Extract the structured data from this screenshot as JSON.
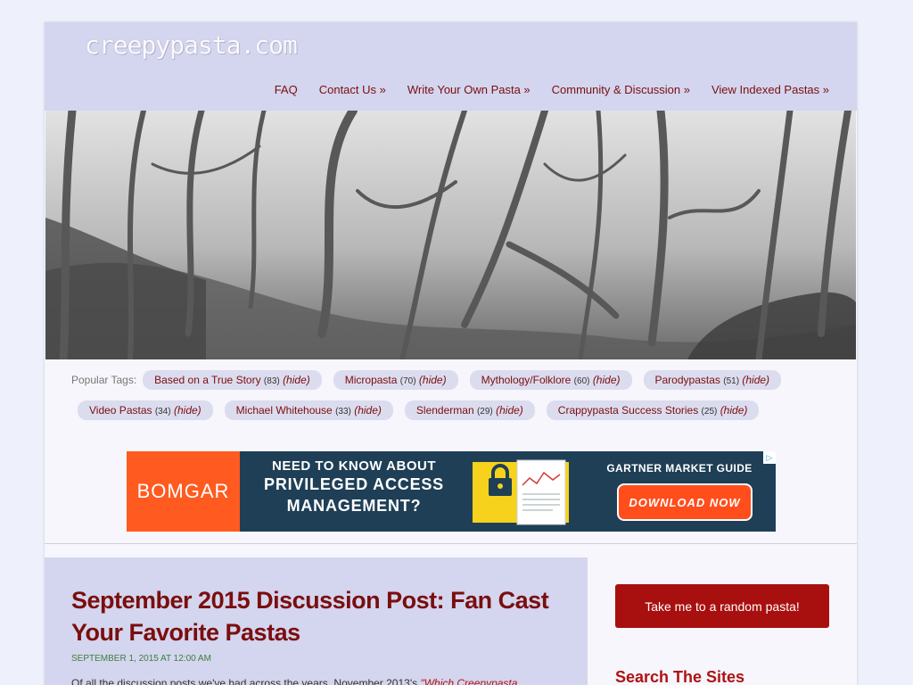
{
  "header": {
    "logo": "creepypasta.com",
    "nav": [
      "FAQ",
      "Contact Us »",
      "Write Your Own Pasta »",
      "Community & Discussion »",
      "View Indexed Pastas »"
    ]
  },
  "tags": {
    "label": "Popular Tags:",
    "hide_label": "(hide)",
    "items": [
      {
        "name": "Based on a True Story",
        "count": "(83)"
      },
      {
        "name": "Micropasta",
        "count": "(70)"
      },
      {
        "name": "Mythology/Folklore",
        "count": "(60)"
      },
      {
        "name": "Parodypastas",
        "count": "(51)"
      },
      {
        "name": "Video Pastas",
        "count": "(34)"
      },
      {
        "name": "Michael Whitehouse",
        "count": "(33)"
      },
      {
        "name": "Slenderman",
        "count": "(29)"
      },
      {
        "name": "Crappypasta Success Stories",
        "count": "(25)"
      }
    ]
  },
  "ad": {
    "brand": "BOMGAR",
    "line1": "NEED TO KNOW ABOUT",
    "line2": "PRIVILEGED ACCESS",
    "line3": "MANAGEMENT?",
    "guide": "GARTNER MARKET GUIDE",
    "cta": "DOWNLOAD NOW",
    "choices_icon": "adchoices-icon",
    "colors": {
      "brand_bg": "#ff5a1f",
      "bg": "#1e3f56",
      "graphic": "#f7d21c"
    }
  },
  "post": {
    "title": "September 2015 Discussion Post: Fan Cast Your Favorite Pastas",
    "date": "SEPTEMBER 1, 2015 AT 12:00 AM",
    "text": "Of all the discussion posts we've had across the years, November 2013's",
    "link": "\"Which Creepypasta"
  },
  "sidebar": {
    "random_button": "Take me to a random pasta!",
    "search_title": "Search The Sites"
  },
  "colors": {
    "accent": "#7a0e0e",
    "button": "#a8100f",
    "header_bg": "#d4d5ee",
    "date": "#3d7f3d"
  }
}
